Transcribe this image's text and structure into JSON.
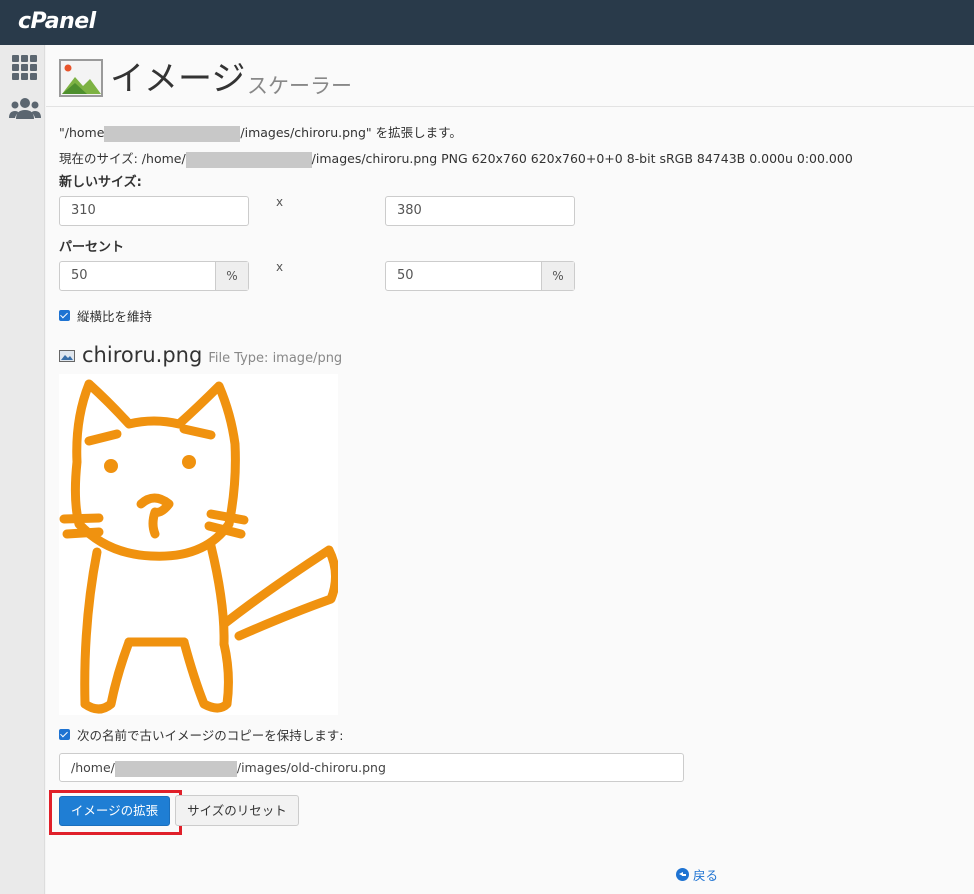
{
  "header": {
    "logo": "cPanel"
  },
  "page": {
    "title": "イメージ",
    "subtitle": "スケーラー"
  },
  "info": {
    "scale_prefix": "\"/home",
    "scale_suffix": "/images/chiroru.png\" を拡張します。",
    "current_prefix": "現在のサイズ: /home/",
    "current_suffix": "/images/chiroru.png PNG 620x760 620x760+0+0 8-bit sRGB 84743B 0.000u 0:00.000"
  },
  "new_size": {
    "label": "新しいサイズ:",
    "width": "310",
    "height": "380",
    "times": "x"
  },
  "percent": {
    "label": "パーセント",
    "width": "50",
    "height": "50",
    "unit": "%",
    "times": "x"
  },
  "keep_aspect": {
    "label": "縦横比を維持",
    "checked": true
  },
  "file": {
    "name": "chiroru.png",
    "type": "File Type: image/png"
  },
  "keep_copy": {
    "label": "次の名前で古いイメージのコピーを保持します:",
    "checked": true
  },
  "copy_path": {
    "prefix": "/home/",
    "suffix": "/images/old-chiroru.png"
  },
  "buttons": {
    "scale": "イメージの拡張",
    "reset": "サイズのリセット"
  },
  "back": {
    "label": "戻る"
  },
  "colors": {
    "header_bg": "#293a4a",
    "primary": "#1f7ed4",
    "highlight": "#e0202a",
    "cat_stroke": "#f0920f"
  }
}
